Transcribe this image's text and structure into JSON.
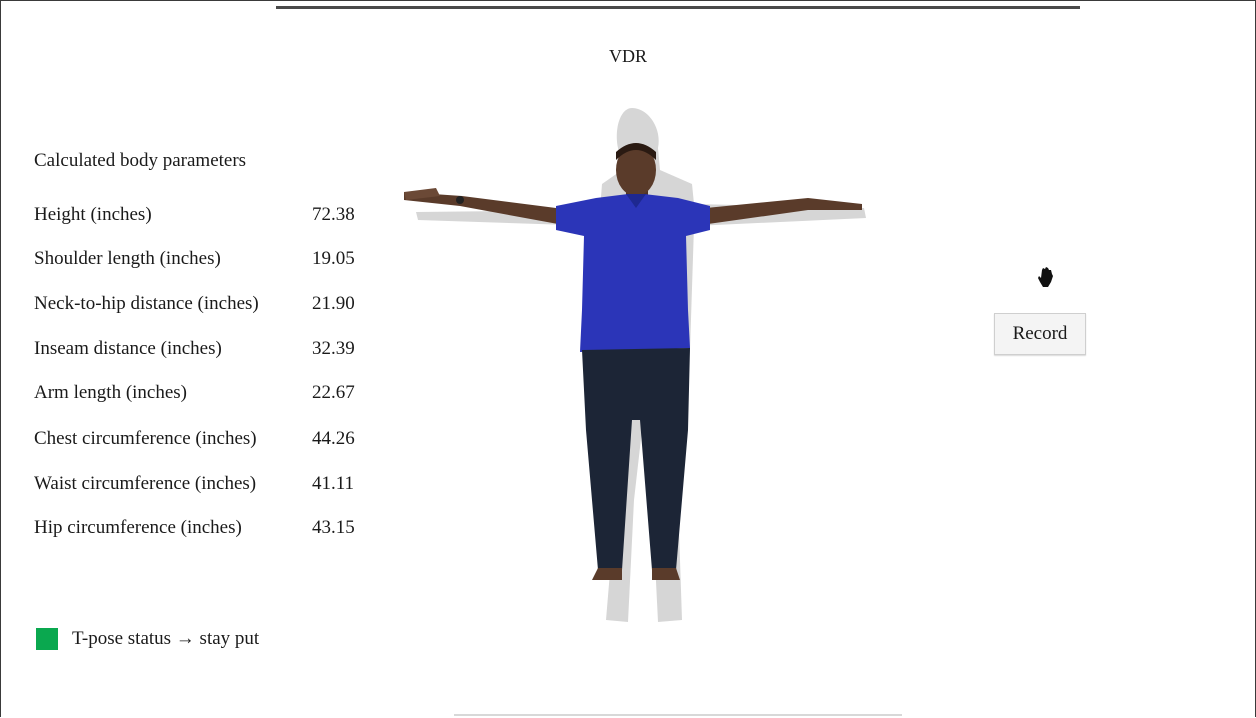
{
  "app": {
    "title": "VDR"
  },
  "parameters": {
    "heading": "Calculated body parameters",
    "rows": [
      {
        "label": "Height (inches)",
        "value": "72.38"
      },
      {
        "label": "Shoulder length (inches)",
        "value": "19.05"
      },
      {
        "label": "Neck-to-hip distance (inches)",
        "value": "21.90"
      },
      {
        "label": "Inseam distance (inches)",
        "value": "32.39"
      },
      {
        "label": "Arm length (inches)",
        "value": "22.67"
      },
      {
        "label": "Chest circumference (inches)",
        "value": "44.26"
      },
      {
        "label": "Waist circumference (inches)",
        "value": "41.11"
      },
      {
        "label": "Hip circumference (inches)",
        "value": "43.15"
      }
    ]
  },
  "status": {
    "text": "T-pose status → stay put",
    "color": "#0aa84f"
  },
  "controls": {
    "record_label": "Record",
    "hand_icon": "hand-icon"
  },
  "colors": {
    "shirt": "#2b35b8",
    "jeans": "#1c2536",
    "skin": "#5a3b2a",
    "silhouette": "#d6d6d6"
  }
}
